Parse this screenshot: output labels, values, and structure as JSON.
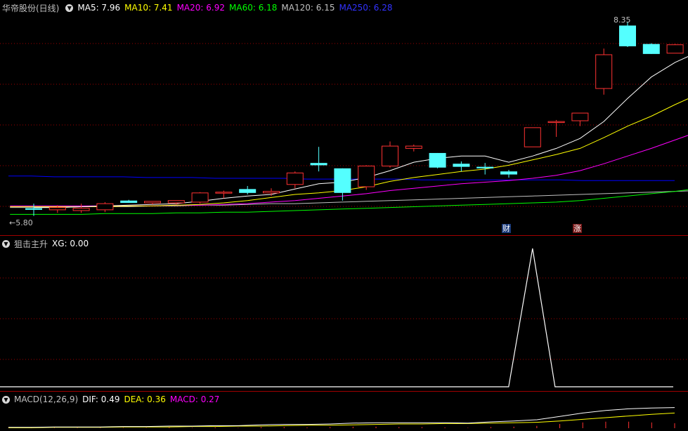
{
  "main": {
    "title": "华帝股份(日线)",
    "ma": [
      {
        "label": "MA5: 7.96",
        "color": "#ffffff"
      },
      {
        "label": "MA10: 7.41",
        "color": "#ffff00"
      },
      {
        "label": "MA20: 6.92",
        "color": "#ff00ff"
      },
      {
        "label": "MA60: 6.18",
        "color": "#00ff00"
      },
      {
        "label": "MA120: 6.15",
        "color": "#c0c0c0"
      },
      {
        "label": "MA250: 6.28",
        "color": "#0000ff"
      }
    ],
    "high_label": "8.35",
    "low_label": "5.80",
    "tag_cai": "财",
    "tag_zhang": "涨"
  },
  "indicator": {
    "name": "狙击主升",
    "value": "XG: 0.00"
  },
  "macd": {
    "name": "MACD(12,26,9)",
    "dif": "DIF: 0.49",
    "dea": "DEA: 0.36",
    "macd": "MACD: 0.27"
  },
  "colors": {
    "up": "#ff3232",
    "down": "#54ffff",
    "grid": "#a00000"
  },
  "candles": [
    {
      "o": 5.92,
      "h": 5.98,
      "l": 5.82,
      "c": 5.9
    },
    {
      "o": 5.9,
      "h": 5.96,
      "l": 5.86,
      "c": 5.93
    },
    {
      "o": 5.89,
      "h": 5.98,
      "l": 5.86,
      "c": 5.92
    },
    {
      "o": 5.9,
      "h": 6.0,
      "l": 5.87,
      "c": 5.98
    },
    {
      "o": 6.02,
      "h": 6.03,
      "l": 5.99,
      "c": 5.99
    },
    {
      "o": 5.99,
      "h": 6.01,
      "l": 5.97,
      "c": 6.01
    },
    {
      "o": 5.99,
      "h": 6.02,
      "l": 5.97,
      "c": 6.02
    },
    {
      "o": 6.0,
      "h": 6.13,
      "l": 5.98,
      "c": 6.12
    },
    {
      "o": 6.13,
      "h": 6.15,
      "l": 6.05,
      "c": 6.13
    },
    {
      "o": 6.17,
      "h": 6.21,
      "l": 6.1,
      "c": 6.12
    },
    {
      "o": 6.12,
      "h": 6.18,
      "l": 6.08,
      "c": 6.14
    },
    {
      "o": 6.23,
      "h": 6.4,
      "l": 6.18,
      "c": 6.38
    },
    {
      "o": 6.51,
      "h": 6.72,
      "l": 6.4,
      "c": 6.48
    },
    {
      "o": 6.44,
      "h": 6.44,
      "l": 6.02,
      "c": 6.12
    },
    {
      "o": 6.2,
      "h": 6.48,
      "l": 6.16,
      "c": 6.47
    },
    {
      "o": 6.47,
      "h": 6.79,
      "l": 6.45,
      "c": 6.73
    },
    {
      "o": 6.7,
      "h": 6.75,
      "l": 6.66,
      "c": 6.73
    },
    {
      "o": 6.64,
      "h": 6.64,
      "l": 6.44,
      "c": 6.45
    },
    {
      "o": 6.5,
      "h": 6.53,
      "l": 6.4,
      "c": 6.46
    },
    {
      "o": 6.46,
      "h": 6.51,
      "l": 6.36,
      "c": 6.44
    },
    {
      "o": 6.4,
      "h": 6.42,
      "l": 6.32,
      "c": 6.36
    },
    {
      "o": 6.72,
      "h": 6.97,
      "l": 6.72,
      "c": 6.97
    },
    {
      "o": 7.04,
      "h": 7.07,
      "l": 6.85,
      "c": 7.05
    },
    {
      "o": 7.06,
      "h": 7.16,
      "l": 6.99,
      "c": 7.16
    },
    {
      "o": 7.48,
      "h": 8.0,
      "l": 7.4,
      "c": 7.92
    },
    {
      "o": 8.3,
      "h": 8.35,
      "l": 8.02,
      "c": 8.03
    },
    {
      "o": 8.06,
      "h": 8.07,
      "l": 7.93,
      "c": 7.93
    },
    {
      "o": 7.94,
      "h": 8.06,
      "l": 7.94,
      "c": 8.05
    },
    {
      "o": 7.98,
      "h": 8.17,
      "l": 7.94,
      "c": 8.1
    }
  ],
  "ma_lines": {
    "ma5": [
      5.93,
      5.93,
      5.94,
      5.95,
      5.96,
      5.97,
      5.98,
      6.01,
      6.05,
      6.08,
      6.1,
      6.17,
      6.24,
      6.26,
      6.32,
      6.41,
      6.52,
      6.57,
      6.6,
      6.6,
      6.52,
      6.6,
      6.7,
      6.83,
      7.05,
      7.35,
      7.63,
      7.82,
      7.96
    ],
    "ma10": [
      5.94,
      5.94,
      5.94,
      5.94,
      5.94,
      5.95,
      5.95,
      5.96,
      5.97,
      5.99,
      6.02,
      6.06,
      6.1,
      6.12,
      6.15,
      6.2,
      6.27,
      6.32,
      6.36,
      6.4,
      6.43,
      6.48,
      6.55,
      6.62,
      6.7,
      6.84,
      6.99,
      7.12,
      7.27,
      7.41
    ],
    "ma20": [
      5.95,
      5.95,
      5.95,
      5.95,
      5.95,
      5.95,
      5.95,
      5.96,
      5.96,
      5.97,
      5.98,
      6.0,
      6.02,
      6.05,
      6.08,
      6.11,
      6.15,
      6.18,
      6.21,
      6.24,
      6.26,
      6.28,
      6.31,
      6.35,
      6.41,
      6.5,
      6.6,
      6.7,
      6.81,
      6.92
    ],
    "ma60": [
      5.84,
      5.84,
      5.84,
      5.84,
      5.85,
      5.85,
      5.85,
      5.86,
      5.86,
      5.87,
      5.87,
      5.88,
      5.89,
      5.9,
      5.91,
      5.92,
      5.93,
      5.94,
      5.95,
      5.96,
      5.97,
      5.98,
      5.99,
      6.0,
      6.02,
      6.05,
      6.08,
      6.11,
      6.14,
      6.18
    ],
    "ma120": [
      5.93,
      5.93,
      5.93,
      5.94,
      5.94,
      5.94,
      5.95,
      5.95,
      5.96,
      5.96,
      5.97,
      5.98,
      5.98,
      5.99,
      6.0,
      6.01,
      6.02,
      6.03,
      6.04,
      6.05,
      6.06,
      6.07,
      6.08,
      6.09,
      6.1,
      6.11,
      6.12,
      6.13,
      6.14,
      6.15
    ],
    "ma250": [
      6.34,
      6.34,
      6.33,
      6.33,
      6.33,
      6.33,
      6.32,
      6.32,
      6.32,
      6.31,
      6.31,
      6.31,
      6.31,
      6.3,
      6.3,
      6.3,
      6.3,
      6.3,
      6.29,
      6.29,
      6.29,
      6.29,
      6.29,
      6.29,
      6.29,
      6.28,
      6.28,
      6.28,
      6.28,
      6.28
    ]
  },
  "xg_signal": [
    0,
    0,
    0,
    0,
    0,
    0,
    0,
    0,
    0,
    0,
    0,
    0,
    0,
    0,
    0,
    0,
    0,
    0,
    0,
    0,
    0,
    1,
    0,
    0,
    0,
    0,
    0,
    0,
    0
  ],
  "macd_series": {
    "dif": [
      0.02,
      0.02,
      0.03,
      0.03,
      0.03,
      0.04,
      0.04,
      0.05,
      0.05,
      0.06,
      0.06,
      0.08,
      0.09,
      0.09,
      0.1,
      0.12,
      0.13,
      0.13,
      0.13,
      0.13,
      0.12,
      0.15,
      0.17,
      0.2,
      0.28,
      0.36,
      0.42,
      0.46,
      0.48,
      0.49
    ],
    "dea": [
      0.01,
      0.01,
      0.02,
      0.02,
      0.02,
      0.03,
      0.03,
      0.03,
      0.04,
      0.04,
      0.05,
      0.05,
      0.06,
      0.07,
      0.07,
      0.08,
      0.09,
      0.1,
      0.1,
      0.11,
      0.11,
      0.12,
      0.13,
      0.14,
      0.17,
      0.21,
      0.25,
      0.29,
      0.33,
      0.36
    ]
  }
}
